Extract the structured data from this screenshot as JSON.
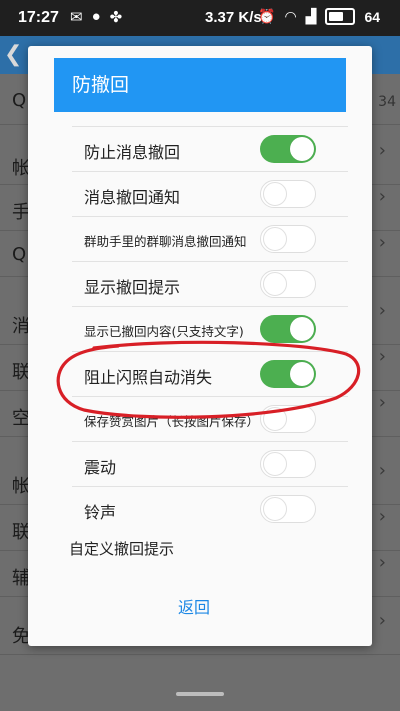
{
  "status_bar": {
    "time": "17:27",
    "left_icons": [
      "sms-icon",
      "wechat-icon",
      "clover-icon"
    ],
    "net_speed": "3.37 K/s",
    "right_icons": [
      "alarm-icon",
      "wifi-icon",
      "4g-signal-icon"
    ],
    "battery": "64"
  },
  "background_app": {
    "header_back_icon": "back-chevron-icon",
    "side_number": "34",
    "rows": [
      {
        "label": "Q"
      },
      {
        "label": "帐"
      },
      {
        "label": "手"
      },
      {
        "label": "Q"
      },
      {
        "label": "消"
      },
      {
        "label": "联"
      },
      {
        "label": "空"
      },
      {
        "label": "帐"
      },
      {
        "label": "联"
      },
      {
        "label": "辅"
      },
      {
        "label": "免"
      }
    ]
  },
  "dialog": {
    "title": "防撤回",
    "options": [
      {
        "label": "防止消息撤回",
        "on": true
      },
      {
        "label": "消息撤回通知",
        "on": false
      },
      {
        "label": "群助手里的群聊消息撤回通知",
        "on": false
      },
      {
        "label": "显示撤回提示",
        "on": false
      },
      {
        "label": "显示已撤回内容(只支持文字)",
        "on": true
      },
      {
        "label": "阻止闪照自动消失",
        "on": true
      },
      {
        "label": "保存赞赏图片（长按图片保存）",
        "on": false
      },
      {
        "label": "震动",
        "on": false
      },
      {
        "label": "铃声",
        "on": false
      }
    ],
    "custom_hint": "自定义撤回提示",
    "back_button": "返回"
  },
  "colors": {
    "accent": "#2196f3",
    "toggle_on": "#4caf50",
    "annotation": "#d81f26"
  }
}
